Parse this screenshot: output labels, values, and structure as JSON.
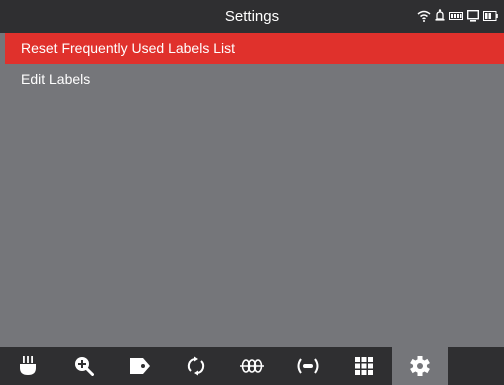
{
  "titlebar": {
    "title": "Settings",
    "status_icons": [
      "wifi-icon",
      "bell-icon",
      "memory-icon",
      "monitor-icon",
      "battery-icon"
    ]
  },
  "menu": {
    "items": [
      {
        "label": "Reset Frequently Used Labels List",
        "selected": true
      },
      {
        "label": "Edit Labels",
        "selected": false
      }
    ]
  },
  "toolbar": {
    "tools": [
      {
        "icon": "probe-icon",
        "active": false
      },
      {
        "icon": "zoom-in-icon",
        "active": false
      },
      {
        "icon": "label-tag-icon",
        "active": false
      },
      {
        "icon": "rotate-icon",
        "active": false
      },
      {
        "icon": "coil-icon",
        "active": false
      },
      {
        "icon": "signal-icon",
        "active": false
      },
      {
        "icon": "grid-icon",
        "active": false
      },
      {
        "icon": "gear-icon",
        "active": true
      }
    ]
  },
  "colors": {
    "background": "#75767a",
    "bar": "#2f2f31",
    "selected": "#e0312c",
    "text": "#ffffff"
  }
}
